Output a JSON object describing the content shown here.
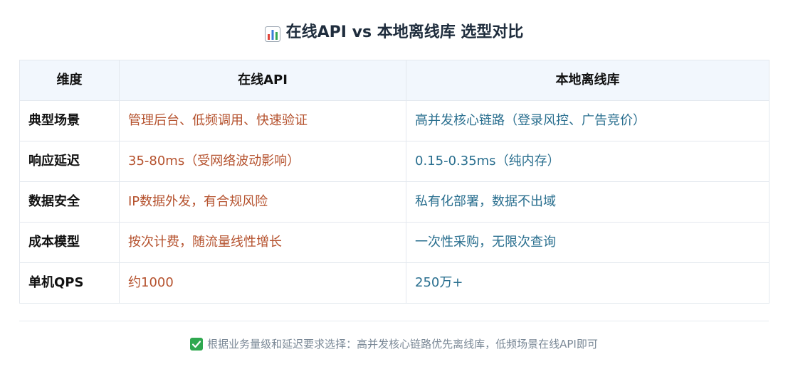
{
  "title": "在线API vs 本地离线库 选型对比",
  "table": {
    "headers": [
      "维度",
      "在线API",
      "本地离线库"
    ],
    "rows": [
      {
        "dimension": "典型场景",
        "online": "管理后台、低频调用、快速验证",
        "local": "高并发核心链路（登录风控、广告竞价）"
      },
      {
        "dimension": "响应延迟",
        "online": "35-80ms（受网络波动影响）",
        "local": "0.15-0.35ms（纯内存）"
      },
      {
        "dimension": "数据安全",
        "online": "IP数据外发，有合规风险",
        "local": "私有化部署，数据不出域"
      },
      {
        "dimension": "成本模型",
        "online": "按次计费，随流量线性增长",
        "local": "一次性采购，无限次查询"
      },
      {
        "dimension": "单机QPS",
        "online": "约1000",
        "local": "250万+"
      }
    ]
  },
  "footer": "根据业务量级和延迟要求选择：高并发核心链路优先离线库，低频场景在线API即可",
  "icons": {
    "title_icon": "bar-chart-icon",
    "footer_icon": "check-mark-icon"
  },
  "colors": {
    "online_text": "#b5522e",
    "local_text": "#2a6f8f",
    "header_bg": "#f2f7fd",
    "check_green": "#2fa84f"
  }
}
